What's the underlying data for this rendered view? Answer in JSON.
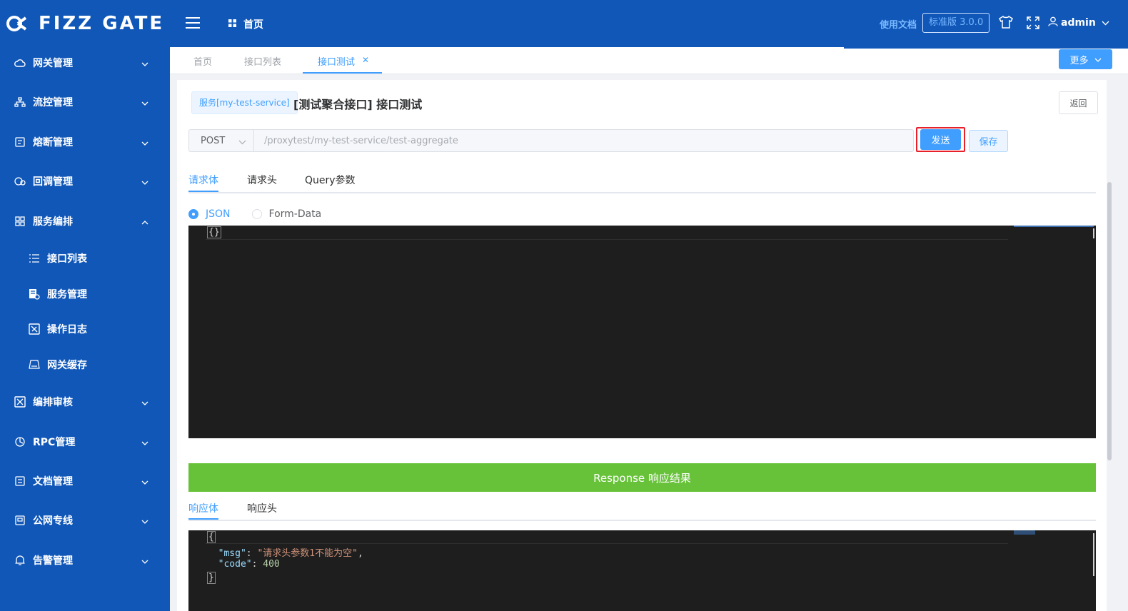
{
  "app": {
    "logo_text": "FIZZ GATE",
    "brand_color": "#1057b8",
    "accent_color": "#409eff"
  },
  "sidebar": {
    "items": [
      {
        "label": "网关管理",
        "icon": "cloud-icon",
        "state": "collapsed"
      },
      {
        "label": "流控管理",
        "icon": "sitemap-icon",
        "state": "collapsed"
      },
      {
        "label": "熔断管理",
        "icon": "breaker-icon",
        "state": "collapsed"
      },
      {
        "label": "回调管理",
        "icon": "callback-icon",
        "state": "collapsed"
      },
      {
        "label": "服务编排",
        "icon": "grid-icon",
        "state": "expanded"
      },
      {
        "label": "编排审核",
        "icon": "audit-icon",
        "state": "collapsed"
      },
      {
        "label": "RPC管理",
        "icon": "rpc-icon",
        "state": "collapsed"
      },
      {
        "label": "文档管理",
        "icon": "doc-icon",
        "state": "collapsed"
      },
      {
        "label": "公网专线",
        "icon": "network-icon",
        "state": "collapsed"
      },
      {
        "label": "告警管理",
        "icon": "bell-icon",
        "state": "collapsed"
      }
    ],
    "sub_items": [
      {
        "label": "接口列表",
        "icon": "list-icon"
      },
      {
        "label": "服务管理",
        "icon": "service-icon"
      },
      {
        "label": "操作日志",
        "icon": "log-icon"
      },
      {
        "label": "网关缓存",
        "icon": "cache-icon"
      }
    ]
  },
  "header": {
    "breadcrumb": "首页",
    "doc_link": "使用文档",
    "version": "标准版 3.0.0",
    "user": "admin"
  },
  "tabs": {
    "items": [
      "首页",
      "接口列表",
      "接口测试"
    ],
    "active": "接口测试",
    "more_label": "更多"
  },
  "page": {
    "service_tag": "服务[my-test-service]",
    "title": "[测试聚合接口] 接口测试",
    "back_label": "返回",
    "method": "POST",
    "url": "/proxytest/my-test-service/test-aggregate",
    "send_label": "发送",
    "save_label": "保存"
  },
  "request": {
    "tabs": [
      "请求体",
      "请求头",
      "Query参数"
    ],
    "active_tab": "请求体",
    "body_types": [
      "JSON",
      "Form-Data"
    ],
    "selected_body_type": "JSON",
    "body": "{}"
  },
  "response": {
    "title": "Response 响应结果",
    "tabs": [
      "响应体",
      "响应头"
    ],
    "active_tab": "响应体",
    "open_brace": "{",
    "close_brace": "}",
    "msg_key": "\"msg\"",
    "msg_value": "\"请求头参数1不能为空\"",
    "code_key": "\"code\"",
    "code_value": "400",
    "success_color": "#67c23a"
  }
}
